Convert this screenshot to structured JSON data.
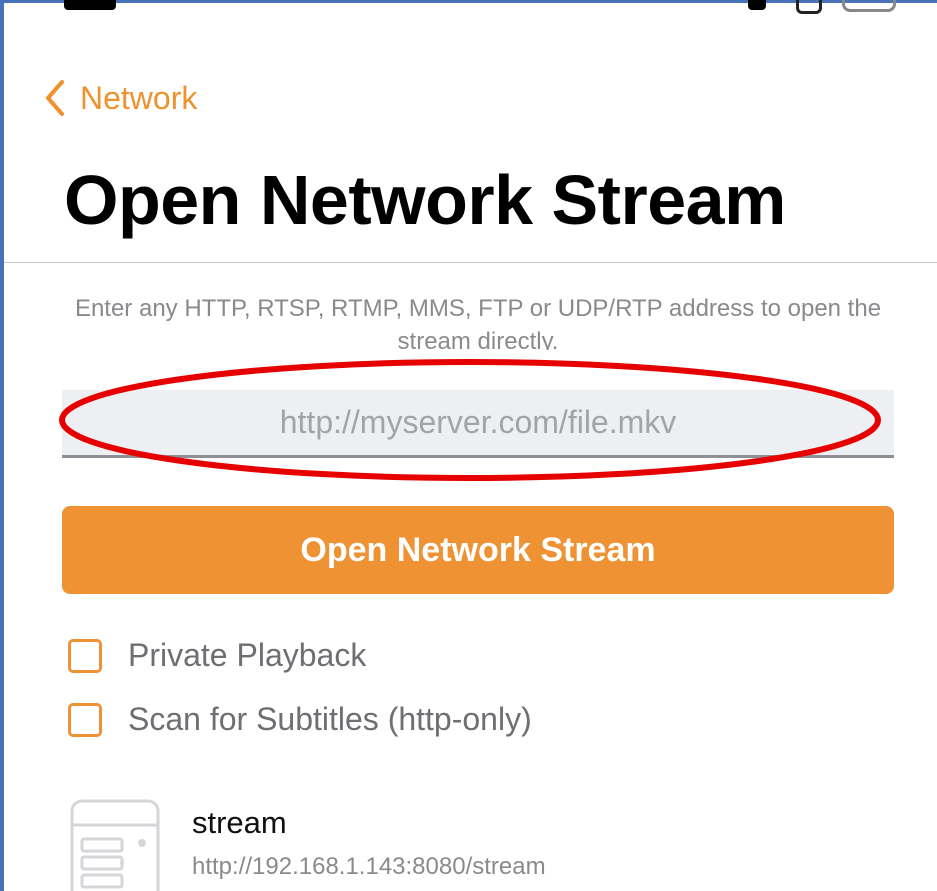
{
  "nav": {
    "back_label": "Network"
  },
  "page": {
    "title": "Open Network Stream",
    "hint": "Enter any HTTP, RTSP, RTMP, MMS, FTP or UDP/RTP address to open the stream directly."
  },
  "url_field": {
    "placeholder": "http://myserver.com/file.mkv",
    "value": ""
  },
  "open_button": {
    "label": "Open Network Stream"
  },
  "options": [
    {
      "label": "Private Playback",
      "checked": false
    },
    {
      "label": "Scan for Subtitles (http-only)",
      "checked": false
    }
  ],
  "recent": [
    {
      "title": "stream",
      "url": "http://192.168.1.143:8080/stream",
      "icon": "server-icon"
    }
  ],
  "colors": {
    "accent": "#ef9233",
    "annotation": "#e60000"
  }
}
